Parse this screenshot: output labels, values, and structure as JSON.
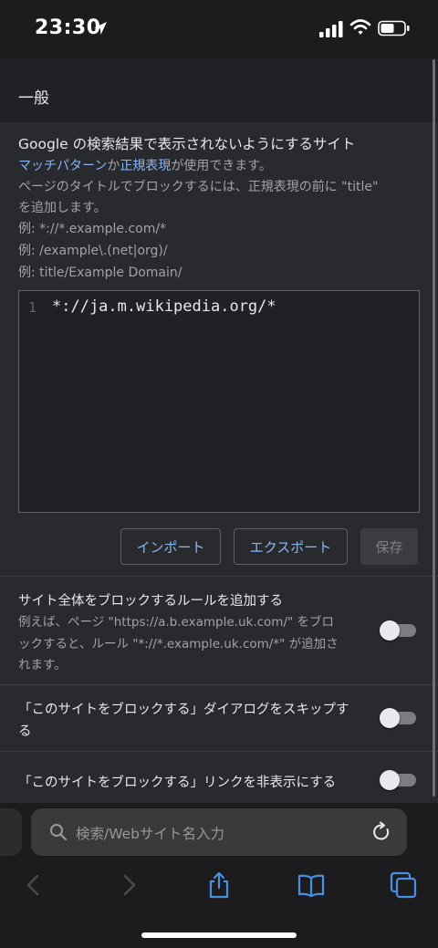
{
  "status": {
    "time": "23:30"
  },
  "header": {
    "title": "一般"
  },
  "blocklist": {
    "heading": "Google の検索結果で表示されないようにするサイト",
    "pattern_link": "マッチパターン",
    "joiner": "か",
    "regex_link": "正規表現",
    "usable_suffix": "が使用できます。",
    "title_note_1": "ページのタイトルでブロックするには、正規表現の前に \"title\"",
    "title_note_2": "を追加します。",
    "example_1": "例: *://*.example.com/*",
    "example_2": "例: /example\\.(net|org)/",
    "example_3": "例: title/Example Domain/",
    "editor": {
      "line_number": "1",
      "line_text": "*://ja.m.wikipedia.org/*"
    },
    "buttons": {
      "import": "インポート",
      "export": "エクスポート",
      "save": "保存"
    }
  },
  "options": [
    {
      "title": "サイト全体をブロックするルールを追加する",
      "desc_1": "例えば、ページ \"https://a.b.example.uk.com/\" をブロ",
      "desc_2": "ックすると、ルール \"*://*.example.uk.com/*\" が追加さ",
      "desc_3": "れます。",
      "enabled": false
    },
    {
      "title_1": "「このサイトをブロックする」ダイアログをスキップす",
      "title_2": "る",
      "enabled": false
    },
    {
      "title": "「このサイトをブロックする」リンクを非表示にする",
      "enabled": false
    }
  ],
  "browser": {
    "address_placeholder": "検索/Webサイト名入力"
  },
  "colors": {
    "accent": "#8ab4f8",
    "safari_blue": "#4a90e2",
    "background": "#292a2d"
  },
  "icons": [
    "location-arrow-icon",
    "signal-icon",
    "wifi-icon",
    "battery-icon",
    "search-icon",
    "reload-icon",
    "back-icon",
    "forward-icon",
    "share-icon",
    "bookmarks-icon",
    "tabs-icon"
  ]
}
